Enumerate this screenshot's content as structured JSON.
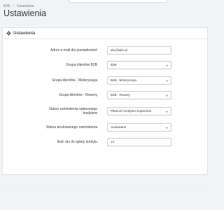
{
  "breadcrumb": {
    "items": [
      "B2B",
      "Ustawienia"
    ]
  },
  "page_title": "Ustawienia",
  "panel": {
    "title": "Ustawienia",
    "icon": "gear-icon"
  },
  "form": {
    "email_label": "Adres e-mail dla powiadomień",
    "email_value": "abc@abc.pl",
    "group_b2b_label": "Grupa klientów B2B",
    "group_b2b_value": "B2B",
    "group_moto_label": "Grupa klientów - Motoryzacja",
    "group_moto_value": "B2B - Motoryzacja",
    "group_bikes_label": "Grupa klientów - Rowery",
    "group_bikes_value": "B2B - Rowery",
    "status_paid_label_1": "Status zamówienia opłaconego",
    "status_paid_label_2": "kredytem",
    "status_paid_value": "Płatność kredytem kupieckim",
    "status_cancel_label": "Status anulowanego zamówienia",
    "status_cancel_value": "Anulowane",
    "credit_days_label": "Ilość dni do spłaty kredytu",
    "credit_days_value": "14"
  },
  "colors": {
    "background": "#f2f3f5",
    "panel": "#ffffff",
    "text": "#363a41"
  }
}
